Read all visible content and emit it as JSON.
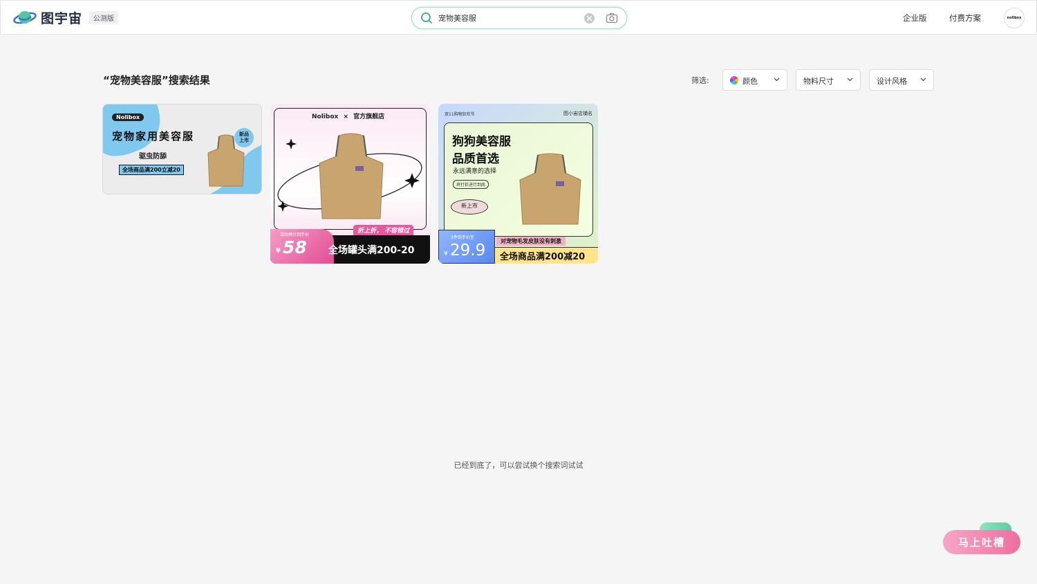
{
  "header": {
    "logo_text": "图宇宙",
    "beta_badge": "公测版",
    "search": {
      "value": "宠物美容服"
    },
    "nav": {
      "enterprise": "企业版",
      "pricing": "付费方案"
    },
    "avatar_text": "nolibox"
  },
  "results": {
    "title": "“宠物美容服”搜索结果",
    "filter_label": "筛选:",
    "filters": {
      "color": "颜色",
      "size": "物料尺寸",
      "style": "设计风格"
    }
  },
  "cards": [
    {
      "brand": "Nolibox",
      "headline": "宠物家用美容服",
      "subline": "驱虫防舔",
      "promo": "全场商品满200立减20",
      "badge_line1": "新品",
      "badge_line2": "上市"
    },
    {
      "brand": "Nolibox",
      "cross": "×",
      "store": "官方旗舰店",
      "slogan": "折上折， 不容错过",
      "price_caption": "活动预计到手价",
      "currency": "¥",
      "price": "58",
      "promo": "全场罐头满200-20"
    },
    {
      "event": "双11购物狂欢节",
      "shop": "图小宙店铺名",
      "headline1": "狗狗美容服",
      "headline2": "品质首选",
      "subline": "永远满意的选择",
      "tag": "将打折进行到底",
      "new_tag": "新上市",
      "price_caption": "3件到手价至",
      "currency": "¥",
      "price": "29.9",
      "notice": "对宠物毛发皮肤没有刺激",
      "promo": "全场商品满200减20"
    }
  ],
  "end_message": "已经到底了，可以尝试换个搜索词试试",
  "feedback_button": "马上吐槽",
  "colors": {
    "accent_green": "#5bcf9f",
    "search_border": "#9fdcc9",
    "pink": "#ee6f9f"
  }
}
